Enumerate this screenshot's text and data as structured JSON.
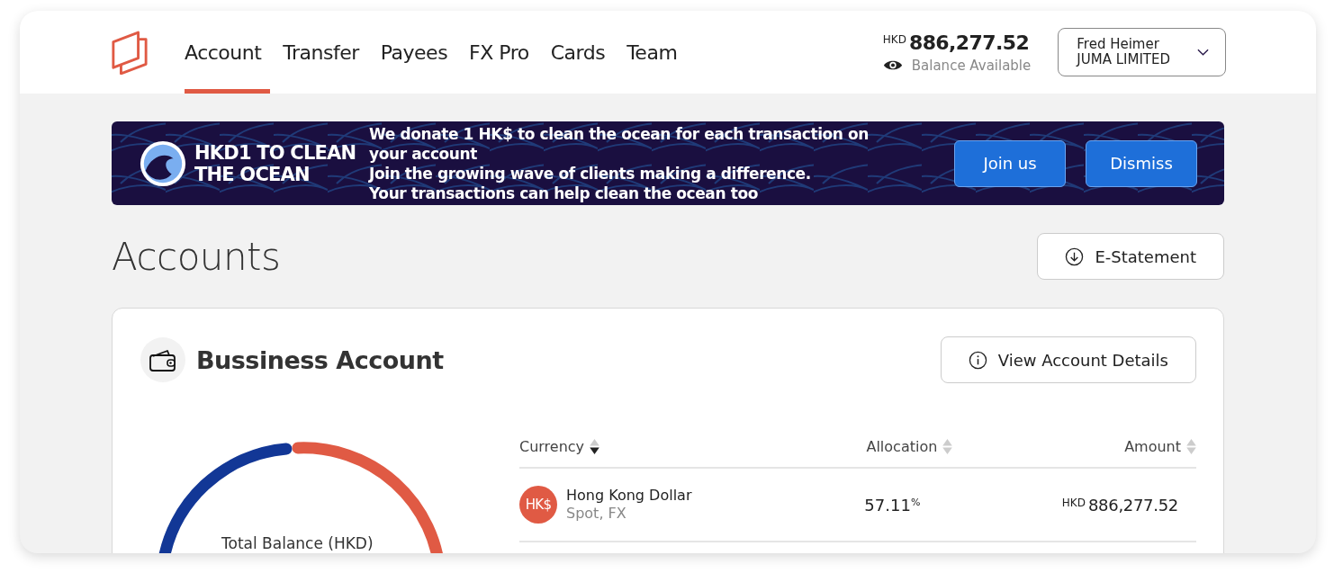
{
  "nav": {
    "tabs": [
      {
        "label": "Account",
        "selected": true
      },
      {
        "label": "Transfer",
        "selected": false
      },
      {
        "label": "Payees",
        "selected": false
      },
      {
        "label": "FX Pro",
        "selected": false
      },
      {
        "label": "Cards",
        "selected": false
      },
      {
        "label": "Team",
        "selected": false
      }
    ],
    "balance": {
      "currency": "HKD",
      "amount": "886,277.52",
      "label": "Balance Available"
    },
    "user": {
      "name": "Fred Heimer",
      "company": "JUMA LIMITED"
    }
  },
  "banner": {
    "title": "HKD1 TO CLEAN THE OCEAN",
    "lines": [
      "We donate 1 HK$ to clean the ocean for each transaction on your account",
      "Join the growing wave of clients making a difference.",
      "Your transactions can help clean the ocean too"
    ],
    "buttons": [
      "Join us",
      "Dismiss"
    ]
  },
  "page": {
    "title": "Accounts",
    "statement_button": "E-Statement"
  },
  "account": {
    "title": "Bussiness Account",
    "details_button": "View Account Details",
    "gauge_label": "Total Balance (HKD)",
    "table": {
      "columns": [
        {
          "label": "Currency",
          "sorted": true
        },
        {
          "label": "Allocation",
          "sorted": false
        },
        {
          "label": "Amount",
          "sorted": false
        }
      ],
      "rows": [
        {
          "badge": "HK$",
          "name": "Hong Kong Dollar",
          "type": "Spot, FX",
          "allocation": "57.11",
          "allocation_unit": "%",
          "amount_currency": "HKD",
          "amount": "886,277.52"
        }
      ]
    }
  }
}
